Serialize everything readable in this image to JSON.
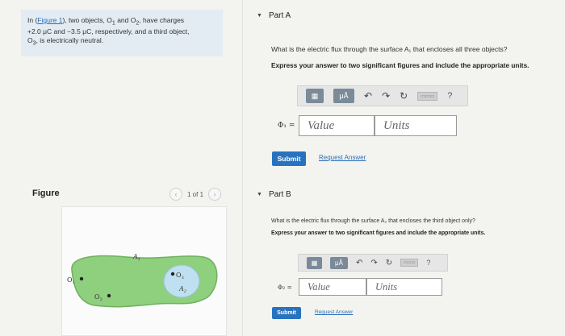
{
  "intro": {
    "prefix": "In (",
    "figure_link": "Figure 1",
    "line1_rest": "), two objects, O",
    "o1_sub": "1",
    "and": " and O",
    "o2_sub": "2",
    "line1_end": ", have charges",
    "line2": "+2.0 μC and −3.5 μC, respectively, and a third object,",
    "line3_o": "O",
    "o3_sub": "3",
    "line3_rest": ", is electrically neutral."
  },
  "figure": {
    "label": "Figure",
    "pager_text": "1 of 1",
    "prev_icon": "‹",
    "next_icon": "›",
    "labels": {
      "o1": "O",
      "o1_sub": "1",
      "o2": "O",
      "o2_sub": "2",
      "o3": "O",
      "o3_sub": "3",
      "a1": "A",
      "a1_sub": "1",
      "a2": "A",
      "a2_sub": "2"
    },
    "colors": {
      "surface_fill": "#8ed07e",
      "surface_stroke": "#6fb060",
      "inner_fill": "#bfe0f0"
    }
  },
  "part_a": {
    "title": "Part A",
    "question": "What is the electric flux through the surface A₁ that encloses all three objects?",
    "instruction": "Express your answer to two significant figures and include the appropriate units.",
    "toolbar": {
      "templates_icon": "▦",
      "mu_label": "μÅ",
      "undo_icon": "↶",
      "redo_icon": "↷",
      "reset_icon": "↻",
      "keyboard_label": "▭▭▭",
      "help_label": "?"
    },
    "symbol": "Φ₁ =",
    "value_placeholder": "Value",
    "units_placeholder": "Units",
    "submit_label": "Submit",
    "request_label": "Request Answer"
  },
  "part_b": {
    "title": "Part B",
    "question": "What is the electric flux through the surface A₂ that encloses the third object only?",
    "instruction": "Express your answer to two significant figures and include the appropriate units.",
    "toolbar": {
      "templates_icon": "▦",
      "mu_label": "μÅ",
      "undo_icon": "↶",
      "redo_icon": "↷",
      "reset_icon": "↻",
      "keyboard_label": "▭▭▭",
      "help_label": "?"
    },
    "symbol": "Φ₂ =",
    "value_placeholder": "Value",
    "units_placeholder": "Units",
    "submit_label": "Submit",
    "request_label": "Request Answer"
  }
}
